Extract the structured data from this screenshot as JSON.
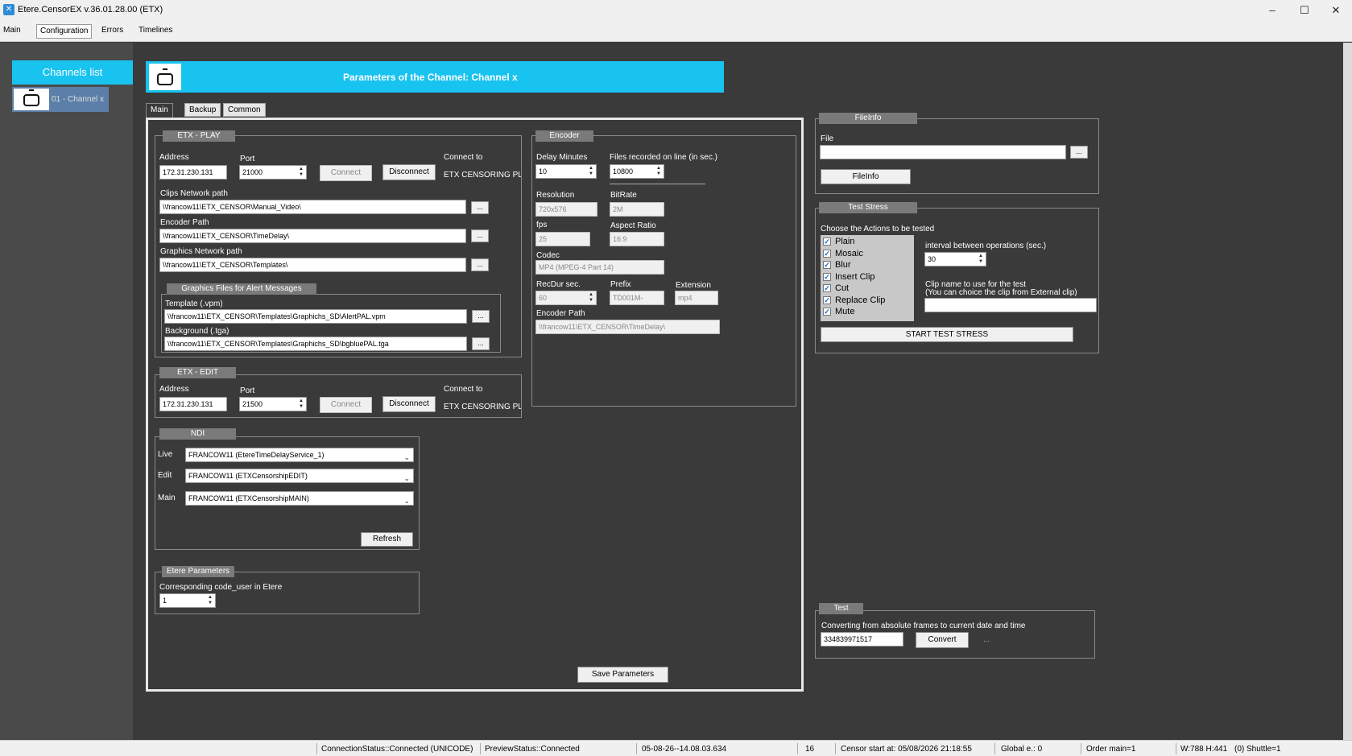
{
  "window": {
    "title": "Etere.CensorEX  v.36.01.28.00 (ETX)",
    "minimize": "–",
    "maximize": "☐",
    "close": "✕"
  },
  "menu": [
    "Main",
    "Configuration",
    "Errors",
    "Timelines"
  ],
  "sidebar": {
    "header": "Channels list",
    "channels": [
      {
        "label": "01 - Channel x"
      }
    ]
  },
  "params": {
    "title": "Parameters of the Channel: Channel x"
  },
  "tabs": [
    "Main",
    "Backup",
    "Common"
  ],
  "etx_play": {
    "title": "ETX - PLAY",
    "address_label": "Address",
    "address": "172.31.230.131",
    "port_label": "Port",
    "port": "21000",
    "connect": "Connect",
    "disconnect": "Disconnect",
    "connect_to_label": "Connect to",
    "connect_to": "ETX CENSORING PL",
    "clips_label": "Clips Network path",
    "clips_path": "\\\\francow11\\ETX_CENSOR\\Manual_Video\\",
    "encoder_label": "Encoder Path",
    "encoder_path": "\\\\francow11\\ETX_CENSOR\\TimeDelay\\",
    "graphics_label": "Graphics Network path",
    "graphics_path": "\\\\francow11\\ETX_CENSOR\\Templates\\",
    "browse": "...",
    "alert_title": "Graphics Files for Alert Messages",
    "template_label": "Template (.vpm)",
    "template_path": "\\\\francow11\\ETX_CENSOR\\Templates\\Graphichs_SD\\AlertPAL.vpm",
    "background_label": "Background (.tga)",
    "background_path": "\\\\francow11\\ETX_CENSOR\\Templates\\Graphichs_SD\\bgbluePAL.tga"
  },
  "etx_edit": {
    "title": "ETX - EDIT",
    "address_label": "Address",
    "address": "172.31.230.131",
    "port_label": "Port",
    "port": "21500",
    "connect": "Connect",
    "disconnect": "Disconnect",
    "connect_to_label": "Connect to",
    "connect_to": "ETX CENSORING PL"
  },
  "ndi": {
    "title": "NDI",
    "live_label": "Live",
    "live": "FRANCOW11 (EtereTimeDelayService_1)",
    "edit_label": "Edit",
    "edit": "FRANCOW11 (ETXCensorshipEDIT)",
    "main_label": "Main",
    "main": "FRANCOW11 (ETXCensorshipMAIN)",
    "refresh": "Refresh"
  },
  "etere_params": {
    "title": "Etere Parameters",
    "code_user_label": "Corresponding code_user in Etere",
    "code_user": "1"
  },
  "encoder": {
    "title": "Encoder",
    "delay_label": "Delay Minutes",
    "delay": "10",
    "files_label": "Files recorded on line (in sec.)",
    "files": "10800",
    "resolution_label": "Resolution",
    "resolution": "720x576",
    "bitrate_label": "BitRate",
    "bitrate": "2M",
    "fps_label": "fps",
    "fps": "25",
    "aspect_label": "Aspect Ratio",
    "aspect": "16:9",
    "codec_label": "Codec",
    "codec": "MP4 (MPEG-4 Part 14)",
    "recdur_label": "RecDur sec.",
    "recdur": "60",
    "prefix_label": "Prefix",
    "prefix": "TD001M-",
    "extension_label": "Extension",
    "extension": "mp4",
    "encpath_label": "Encoder Path",
    "encpath": "\\\\francow11\\ETX_CENSOR\\TimeDelay\\"
  },
  "save": "Save Parameters",
  "fileinfo": {
    "title": "FileInfo",
    "file_label": "File",
    "file": "",
    "browse": "...",
    "button": "FileInfo"
  },
  "stress": {
    "title": "Test Stress",
    "choose_label": "Choose the Actions to be tested",
    "actions": [
      {
        "label": "Plain",
        "checked": true
      },
      {
        "label": "Mosaic",
        "checked": true
      },
      {
        "label": "Blur",
        "checked": true
      },
      {
        "label": "Insert Clip",
        "checked": true
      },
      {
        "label": "Cut",
        "checked": true
      },
      {
        "label": "Replace Clip",
        "checked": true
      },
      {
        "label": "Mute",
        "checked": true
      }
    ],
    "check_glyph": "✓",
    "interval_label": "interval between operations (sec.)",
    "interval": "30",
    "clip_label1": "Clip name to use for the test",
    "clip_label2": "(You can choice the clip from External clip)",
    "clip": "",
    "start": "START TEST STRESS"
  },
  "test": {
    "title": "Test",
    "desc": "Converting from absolute frames to current date and time",
    "value": "334839971517",
    "convert": "Convert",
    "result": "..."
  },
  "status": {
    "connection": "ConnectionStatus::Connected (UNICODE)",
    "preview": "PreviewStatus::Connected",
    "time": "05-08-26--14.08.03.634",
    "count": "16",
    "censor_start": "Censor start at: 05/08/2026 21:18:55",
    "global": "Global e.: 0",
    "order": "Order main=1",
    "dims": "W:788 H:441",
    "shuttle": "(0) Shuttle=1"
  }
}
